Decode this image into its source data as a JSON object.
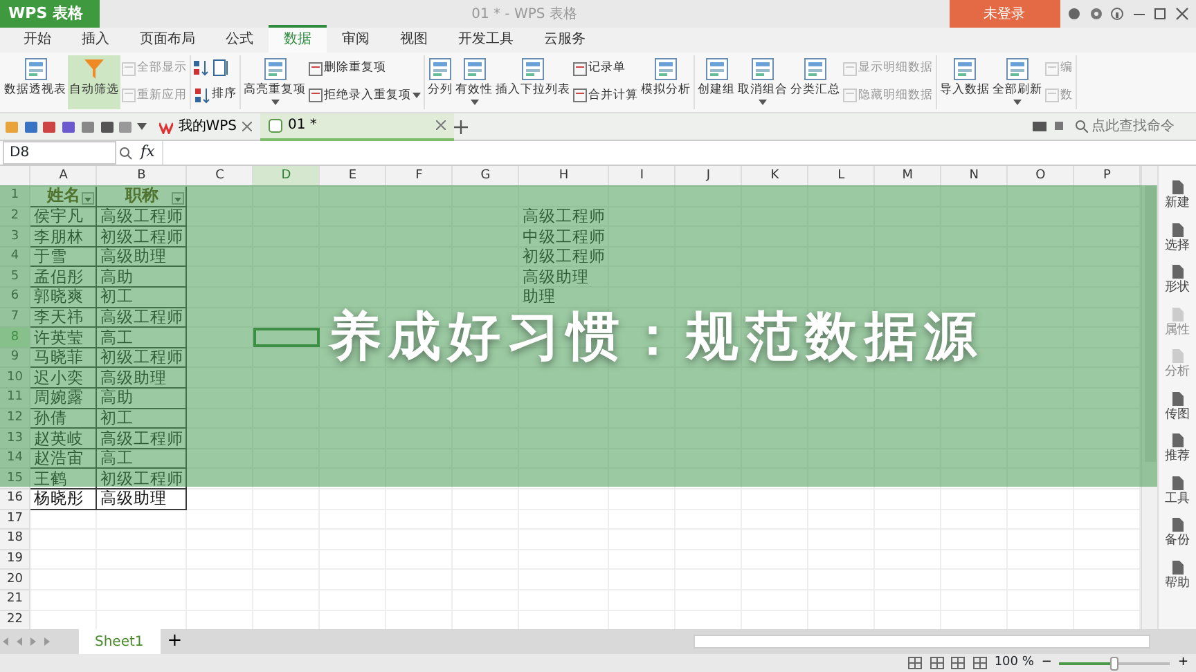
{
  "titlebar": {
    "logo": "WPS 表格",
    "title": "01 * - WPS 表格",
    "login": "未登录"
  },
  "menu_tabs": [
    {
      "label": "开始",
      "selected": false
    },
    {
      "label": "插入",
      "selected": false
    },
    {
      "label": "页面布局",
      "selected": false
    },
    {
      "label": "公式",
      "selected": false
    },
    {
      "label": "数据",
      "selected": true
    },
    {
      "label": "审阅",
      "selected": false
    },
    {
      "label": "视图",
      "selected": false
    },
    {
      "label": "开发工具",
      "selected": false
    },
    {
      "label": "云服务",
      "selected": false
    }
  ],
  "ribbon": [
    {
      "items": [
        {
          "kind": "large",
          "label": "数据透视表",
          "dropdown": false,
          "active": false
        },
        {
          "kind": "large",
          "label": "自动筛选",
          "dropdown": false,
          "active": true
        },
        {
          "kind": "stack",
          "items": [
            {
              "label": "全部显示",
              "disabled": true,
              "dropdown": false
            },
            {
              "label": "重新应用",
              "disabled": true,
              "dropdown": false
            }
          ]
        }
      ]
    },
    {
      "items": [
        {
          "kind": "sort",
          "label": "排序"
        }
      ]
    },
    {
      "items": [
        {
          "kind": "large",
          "label": "高亮重复项",
          "dropdown": true,
          "active": false
        },
        {
          "kind": "stack",
          "items": [
            {
              "label": "删除重复项",
              "disabled": false,
              "dropdown": false
            },
            {
              "label": "拒绝录入重复项",
              "disabled": false,
              "dropdown": true
            }
          ]
        }
      ]
    },
    {
      "items": [
        {
          "kind": "large",
          "label": "分列",
          "dropdown": false,
          "active": false
        },
        {
          "kind": "large",
          "label": "有效性",
          "dropdown": true,
          "active": false
        },
        {
          "kind": "large",
          "label": "插入下拉列表",
          "dropdown": false,
          "active": false
        },
        {
          "kind": "stack",
          "items": [
            {
              "label": "记录单",
              "disabled": false,
              "dropdown": false
            },
            {
              "label": "合并计算",
              "disabled": false,
              "dropdown": false
            }
          ]
        },
        {
          "kind": "large",
          "label": "模拟分析",
          "dropdown": false,
          "active": false
        }
      ]
    },
    {
      "items": [
        {
          "kind": "large",
          "label": "创建组",
          "dropdown": false,
          "active": false
        },
        {
          "kind": "large",
          "label": "取消组合",
          "dropdown": true,
          "active": false
        },
        {
          "kind": "large",
          "label": "分类汇总",
          "dropdown": false,
          "active": false
        },
        {
          "kind": "stack",
          "items": [
            {
              "label": "显示明细数据",
              "disabled": true,
              "dropdown": false
            },
            {
              "label": "隐藏明细数据",
              "disabled": true,
              "dropdown": false
            }
          ]
        }
      ]
    },
    {
      "items": [
        {
          "kind": "large",
          "label": "导入数据",
          "dropdown": false,
          "active": false
        },
        {
          "kind": "large",
          "label": "全部刷新",
          "dropdown": true,
          "active": false
        },
        {
          "kind": "stack",
          "items": [
            {
              "label": "编",
              "disabled": true,
              "dropdown": false
            },
            {
              "label": "数",
              "disabled": true,
              "dropdown": false
            }
          ]
        }
      ]
    }
  ],
  "doc_tabs": [
    {
      "label": "我的WPS",
      "selected": false
    },
    {
      "label": "01 *",
      "selected": true
    }
  ],
  "command_search": {
    "placeholder": "点此查找命令"
  },
  "formula_bar": {
    "name_box": "D8",
    "fx": "fx"
  },
  "sheet": {
    "columns": [
      {
        "label": "A",
        "selected": false
      },
      {
        "label": "B",
        "selected": false
      },
      {
        "label": "C",
        "selected": false
      },
      {
        "label": "D",
        "selected": true
      },
      {
        "label": "E",
        "selected": false
      },
      {
        "label": "F",
        "selected": false
      },
      {
        "label": "G",
        "selected": false
      },
      {
        "label": "H",
        "selected": false
      },
      {
        "label": "I",
        "selected": false
      },
      {
        "label": "J",
        "selected": false
      },
      {
        "label": "K",
        "selected": false
      },
      {
        "label": "L",
        "selected": false
      },
      {
        "label": "M",
        "selected": false
      },
      {
        "label": "N",
        "selected": false
      },
      {
        "label": "O",
        "selected": false
      },
      {
        "label": "P",
        "selected": false
      }
    ],
    "rows": [
      {
        "number": "1",
        "kind": "header",
        "selected": false,
        "cells": {
          "A": "姓名",
          "B": "职称"
        }
      },
      {
        "number": "2",
        "kind": "record",
        "selected": false,
        "cells": {
          "A": "侯宇凡",
          "B": "高级工程师",
          "H": "高级工程师"
        }
      },
      {
        "number": "3",
        "kind": "record",
        "selected": false,
        "cells": {
          "A": "李朋林",
          "B": "初级工程师",
          "H": "中级工程师"
        }
      },
      {
        "number": "4",
        "kind": "record",
        "selected": false,
        "cells": {
          "A": "于雪",
          "B": "高级助理",
          "H": "初级工程师"
        }
      },
      {
        "number": "5",
        "kind": "record",
        "selected": false,
        "cells": {
          "A": "孟侣彤",
          "B": "高助",
          "H": "高级助理"
        }
      },
      {
        "number": "6",
        "kind": "record",
        "selected": false,
        "cells": {
          "A": "郭晓爽",
          "B": "初工",
          "H": "助理"
        }
      },
      {
        "number": "7",
        "kind": "record",
        "selected": false,
        "cells": {
          "A": "李天祎",
          "B": "高级工程师"
        }
      },
      {
        "number": "8",
        "kind": "record",
        "selected": true,
        "cells": {
          "A": "许英莹",
          "B": "高工"
        }
      },
      {
        "number": "9",
        "kind": "record",
        "selected": false,
        "cells": {
          "A": "马晓菲",
          "B": "初级工程师"
        }
      },
      {
        "number": "10",
        "kind": "record",
        "selected": false,
        "cells": {
          "A": "迟小奕",
          "B": "高级助理"
        }
      },
      {
        "number": "11",
        "kind": "record",
        "selected": false,
        "cells": {
          "A": "周婉露",
          "B": "高助"
        }
      },
      {
        "number": "12",
        "kind": "record",
        "selected": false,
        "cells": {
          "A": "孙倩",
          "B": "初工"
        }
      },
      {
        "number": "13",
        "kind": "record",
        "selected": false,
        "cells": {
          "A": "赵英岐",
          "B": "高级工程师"
        }
      },
      {
        "number": "14",
        "kind": "record",
        "selected": false,
        "cells": {
          "A": "赵浩宙",
          "B": "高工"
        }
      },
      {
        "number": "15",
        "kind": "record",
        "selected": false,
        "cells": {
          "A": "王鹤",
          "B": "初级工程师"
        }
      },
      {
        "number": "16",
        "kind": "record",
        "selected": false,
        "cells": {
          "A": "杨晓彤",
          "B": "高级助理"
        }
      },
      {
        "number": "17",
        "kind": "plain",
        "selected": false
      },
      {
        "number": "18",
        "kind": "plain",
        "selected": false
      },
      {
        "number": "19",
        "kind": "plain",
        "selected": false
      },
      {
        "number": "20",
        "kind": "plain",
        "selected": false
      },
      {
        "number": "21",
        "kind": "plain",
        "selected": false
      },
      {
        "number": "22",
        "kind": "plain",
        "selected": false
      }
    ]
  },
  "side_panel": [
    {
      "label": "新建",
      "disabled": false
    },
    {
      "label": "选择",
      "disabled": false
    },
    {
      "label": "形状",
      "disabled": false
    },
    {
      "label": "属性",
      "disabled": true
    },
    {
      "label": "分析",
      "disabled": true
    },
    {
      "label": "传图",
      "disabled": false
    },
    {
      "label": "推荐",
      "disabled": false
    },
    {
      "label": "工具",
      "disabled": false
    },
    {
      "label": "备份",
      "disabled": false
    },
    {
      "label": "帮助",
      "disabled": false
    }
  ],
  "sheet_tabs": [
    {
      "label": "Sheet1",
      "selected": true
    }
  ],
  "add_sheet": "+",
  "status_bar": {
    "zoom": "100 %",
    "zoom_out": "−",
    "zoom_in": "+",
    "level": 0.5
  },
  "banner": {
    "title": "养成好习惯：规范数据源"
  }
}
